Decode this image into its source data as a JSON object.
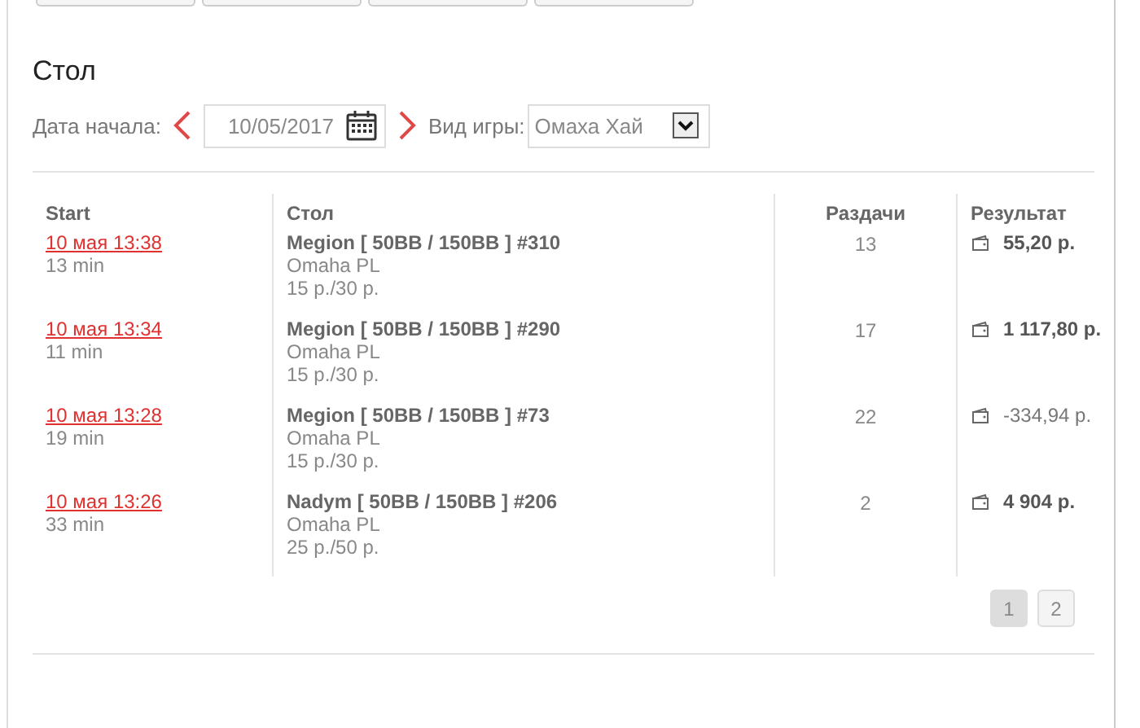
{
  "title": "Стол",
  "filters": {
    "date_label": "Дата начала:",
    "date_value": "10/05/2017",
    "game_label": "Вид игры:",
    "game_value": "Омаха Хай"
  },
  "table": {
    "columns": [
      "Start",
      "Стол",
      "Раздачи",
      "Результат"
    ],
    "rows": [
      {
        "start": "10 мая 13:38",
        "duration": "13 min",
        "table": "Megion [ 50BB / 150BB ] #310",
        "game": "Omaha PL",
        "stakes": "15 р./30 р.",
        "hands": "13",
        "result": "55,20 р.",
        "positive": true
      },
      {
        "start": "10 мая 13:34",
        "duration": "11 min",
        "table": "Megion [ 50BB / 150BB ] #290",
        "game": "Omaha PL",
        "stakes": "15 р./30 р.",
        "hands": "17",
        "result": "1 117,80 р.",
        "positive": true
      },
      {
        "start": "10 мая 13:28",
        "duration": "19 min",
        "table": "Megion [ 50BB / 150BB ] #73",
        "game": "Omaha PL",
        "stakes": "15 р./30 р.",
        "hands": "22",
        "result": "-334,94 р.",
        "positive": false
      },
      {
        "start": "10 мая 13:26",
        "duration": "33 min",
        "table": "Nadym [ 50BB / 150BB ] #206",
        "game": "Omaha PL",
        "stakes": "25 р./50 р.",
        "hands": "2",
        "result": "4 904 р.",
        "positive": true
      }
    ]
  },
  "pagination": [
    {
      "label": "1",
      "selected": true
    },
    {
      "label": "2",
      "selected": false
    }
  ]
}
